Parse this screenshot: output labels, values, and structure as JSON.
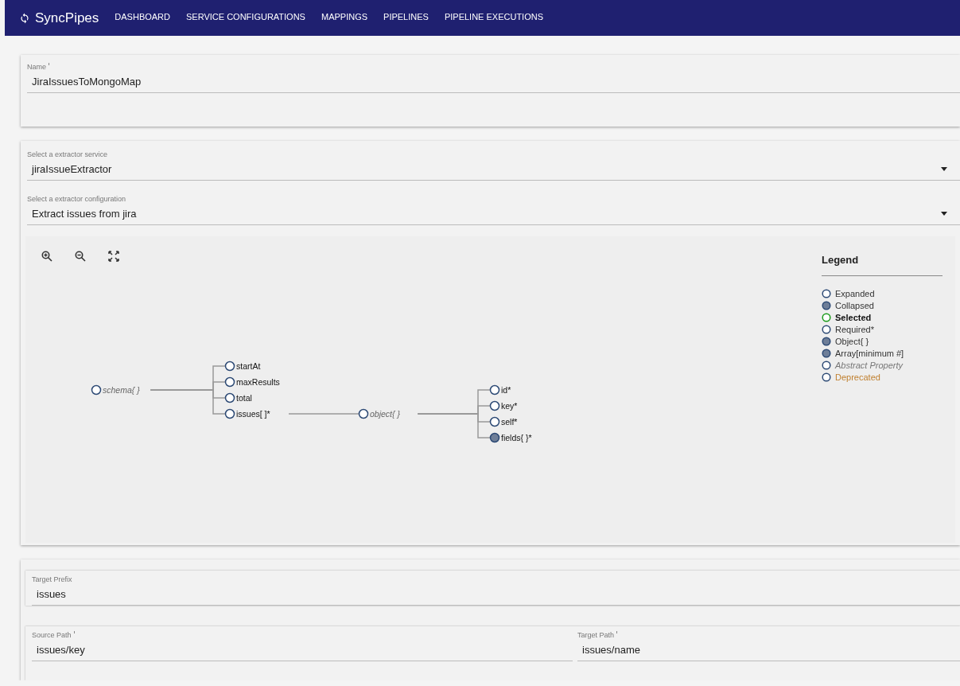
{
  "nav": {
    "brand": "SyncPipes",
    "items": [
      {
        "label": "DASHBOARD",
        "selected": false
      },
      {
        "label": "SERVICE CONFIGURATIONS",
        "selected": false
      },
      {
        "label": "MAPPINGS",
        "selected": false
      },
      {
        "label": "PIPELINES",
        "selected": false
      },
      {
        "label": "PIPELINE EXECUTIONS",
        "selected": false
      }
    ]
  },
  "name_field": {
    "label": "Name",
    "required": true,
    "value": "JiraIssuesToMongoMap"
  },
  "selects": [
    {
      "label": "Select a extractor service",
      "value": "jiraIssueExtractor"
    },
    {
      "label": "Select a extractor configuration",
      "value": "Extract issues from jira"
    }
  ],
  "schema_tree": {
    "label": "schema{ }",
    "kind": "abstract",
    "collapsed": false,
    "children": [
      {
        "label": "startAt",
        "kind": "property",
        "collapsed": false
      },
      {
        "label": "maxResults",
        "kind": "property",
        "collapsed": false
      },
      {
        "label": "total",
        "kind": "property",
        "collapsed": false
      },
      {
        "label": "issues[ ]*",
        "kind": "property",
        "collapsed": false,
        "children": [
          {
            "label": "object{ }",
            "kind": "abstract",
            "collapsed": false,
            "children": [
              {
                "label": "id*",
                "kind": "property",
                "collapsed": false
              },
              {
                "label": "key*",
                "kind": "property",
                "collapsed": false
              },
              {
                "label": "self*",
                "kind": "property",
                "collapsed": false
              },
              {
                "label": "fields{ }*",
                "kind": "property",
                "collapsed": true
              }
            ]
          }
        ]
      }
    ]
  },
  "legend": {
    "title": "Legend",
    "items": [
      {
        "label": "Expanded",
        "kind": "expanded"
      },
      {
        "label": "Collapsed",
        "kind": "collapsed"
      },
      {
        "label": "Selected",
        "kind": "selected"
      },
      {
        "label": "Required*",
        "kind": "required"
      },
      {
        "label": "Object{ }",
        "kind": "object"
      },
      {
        "label": "Array[minimum #]",
        "kind": "array"
      },
      {
        "label": "Abstract Property",
        "kind": "abstract"
      },
      {
        "label": "Deprecated",
        "kind": "deprecated"
      }
    ]
  },
  "target_prefix": {
    "label": "Target Prefix",
    "value": "issues"
  },
  "mapping_row": [
    {
      "label": "Source Path",
      "required": true,
      "value": "issues/key"
    },
    {
      "label": "Target Path",
      "required": true,
      "value": "issues/name"
    }
  ]
}
